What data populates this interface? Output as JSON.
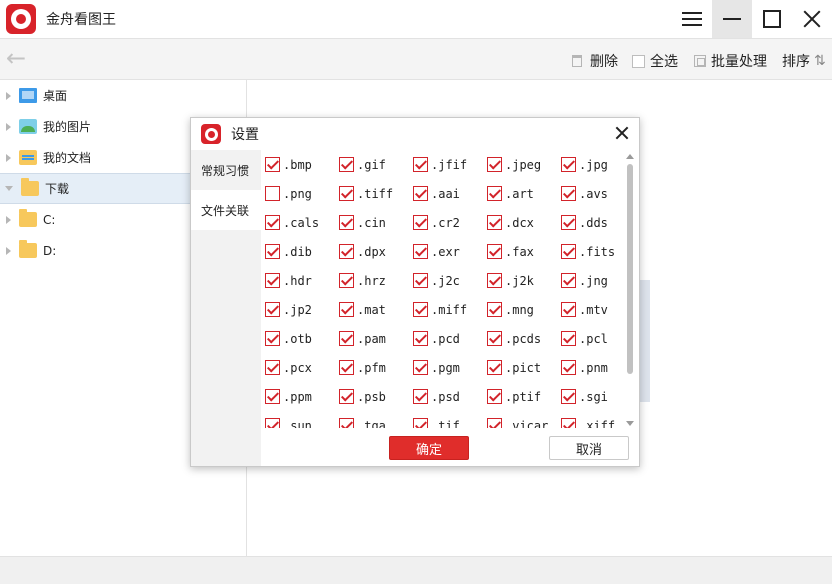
{
  "app": {
    "title": "金舟看图王"
  },
  "toolbar": {
    "delete_label": "删除",
    "select_all_label": "全选",
    "batch_label": "批量处理",
    "sort_label": "排序"
  },
  "sidebar": {
    "items": [
      {
        "label": "桌面",
        "icon": "desktop-icon"
      },
      {
        "label": "我的图片",
        "icon": "pictures-icon"
      },
      {
        "label": "我的文档",
        "icon": "documents-icon"
      },
      {
        "label": "下载",
        "icon": "folder-icon",
        "selected": true
      },
      {
        "label": "C:",
        "icon": "folder-icon"
      },
      {
        "label": "D:",
        "icon": "folder-icon"
      }
    ]
  },
  "dialog": {
    "title": "设置",
    "tabs": [
      {
        "label": "常规习惯"
      },
      {
        "label": "文件关联"
      }
    ],
    "ok_label": "确定",
    "cancel_label": "取消",
    "formats": [
      {
        "ext": ".bmp",
        "checked": true
      },
      {
        "ext": ".gif",
        "checked": true
      },
      {
        "ext": ".jfif",
        "checked": true
      },
      {
        "ext": ".jpeg",
        "checked": true
      },
      {
        "ext": ".jpg",
        "checked": true
      },
      {
        "ext": ".png",
        "checked": false
      },
      {
        "ext": ".tiff",
        "checked": true
      },
      {
        "ext": ".aai",
        "checked": true
      },
      {
        "ext": ".art",
        "checked": true
      },
      {
        "ext": ".avs",
        "checked": true
      },
      {
        "ext": ".cals",
        "checked": true
      },
      {
        "ext": ".cin",
        "checked": true
      },
      {
        "ext": ".cr2",
        "checked": true
      },
      {
        "ext": ".dcx",
        "checked": true
      },
      {
        "ext": ".dds",
        "checked": true
      },
      {
        "ext": ".dib",
        "checked": true
      },
      {
        "ext": ".dpx",
        "checked": true
      },
      {
        "ext": ".exr",
        "checked": true
      },
      {
        "ext": ".fax",
        "checked": true
      },
      {
        "ext": ".fits",
        "checked": true
      },
      {
        "ext": ".hdr",
        "checked": true
      },
      {
        "ext": ".hrz",
        "checked": true
      },
      {
        "ext": ".j2c",
        "checked": true
      },
      {
        "ext": ".j2k",
        "checked": true
      },
      {
        "ext": ".jng",
        "checked": true
      },
      {
        "ext": ".jp2",
        "checked": true
      },
      {
        "ext": ".mat",
        "checked": true
      },
      {
        "ext": ".miff",
        "checked": true
      },
      {
        "ext": ".mng",
        "checked": true
      },
      {
        "ext": ".mtv",
        "checked": true
      },
      {
        "ext": ".otb",
        "checked": true
      },
      {
        "ext": ".pam",
        "checked": true
      },
      {
        "ext": ".pcd",
        "checked": true
      },
      {
        "ext": ".pcds",
        "checked": true
      },
      {
        "ext": ".pcl",
        "checked": true
      },
      {
        "ext": ".pcx",
        "checked": true
      },
      {
        "ext": ".pfm",
        "checked": true
      },
      {
        "ext": ".pgm",
        "checked": true
      },
      {
        "ext": ".pict",
        "checked": true
      },
      {
        "ext": ".pnm",
        "checked": true
      },
      {
        "ext": ".ppm",
        "checked": true
      },
      {
        "ext": ".psb",
        "checked": true
      },
      {
        "ext": ".psd",
        "checked": true
      },
      {
        "ext": ".ptif",
        "checked": true
      },
      {
        "ext": ".sgi",
        "checked": true
      },
      {
        "ext": ".sun",
        "checked": true
      },
      {
        "ext": ".tga",
        "checked": true
      },
      {
        "ext": ".tif",
        "checked": true
      },
      {
        "ext": ".vicar",
        "checked": true
      },
      {
        "ext": ".xiff",
        "checked": true
      }
    ]
  }
}
